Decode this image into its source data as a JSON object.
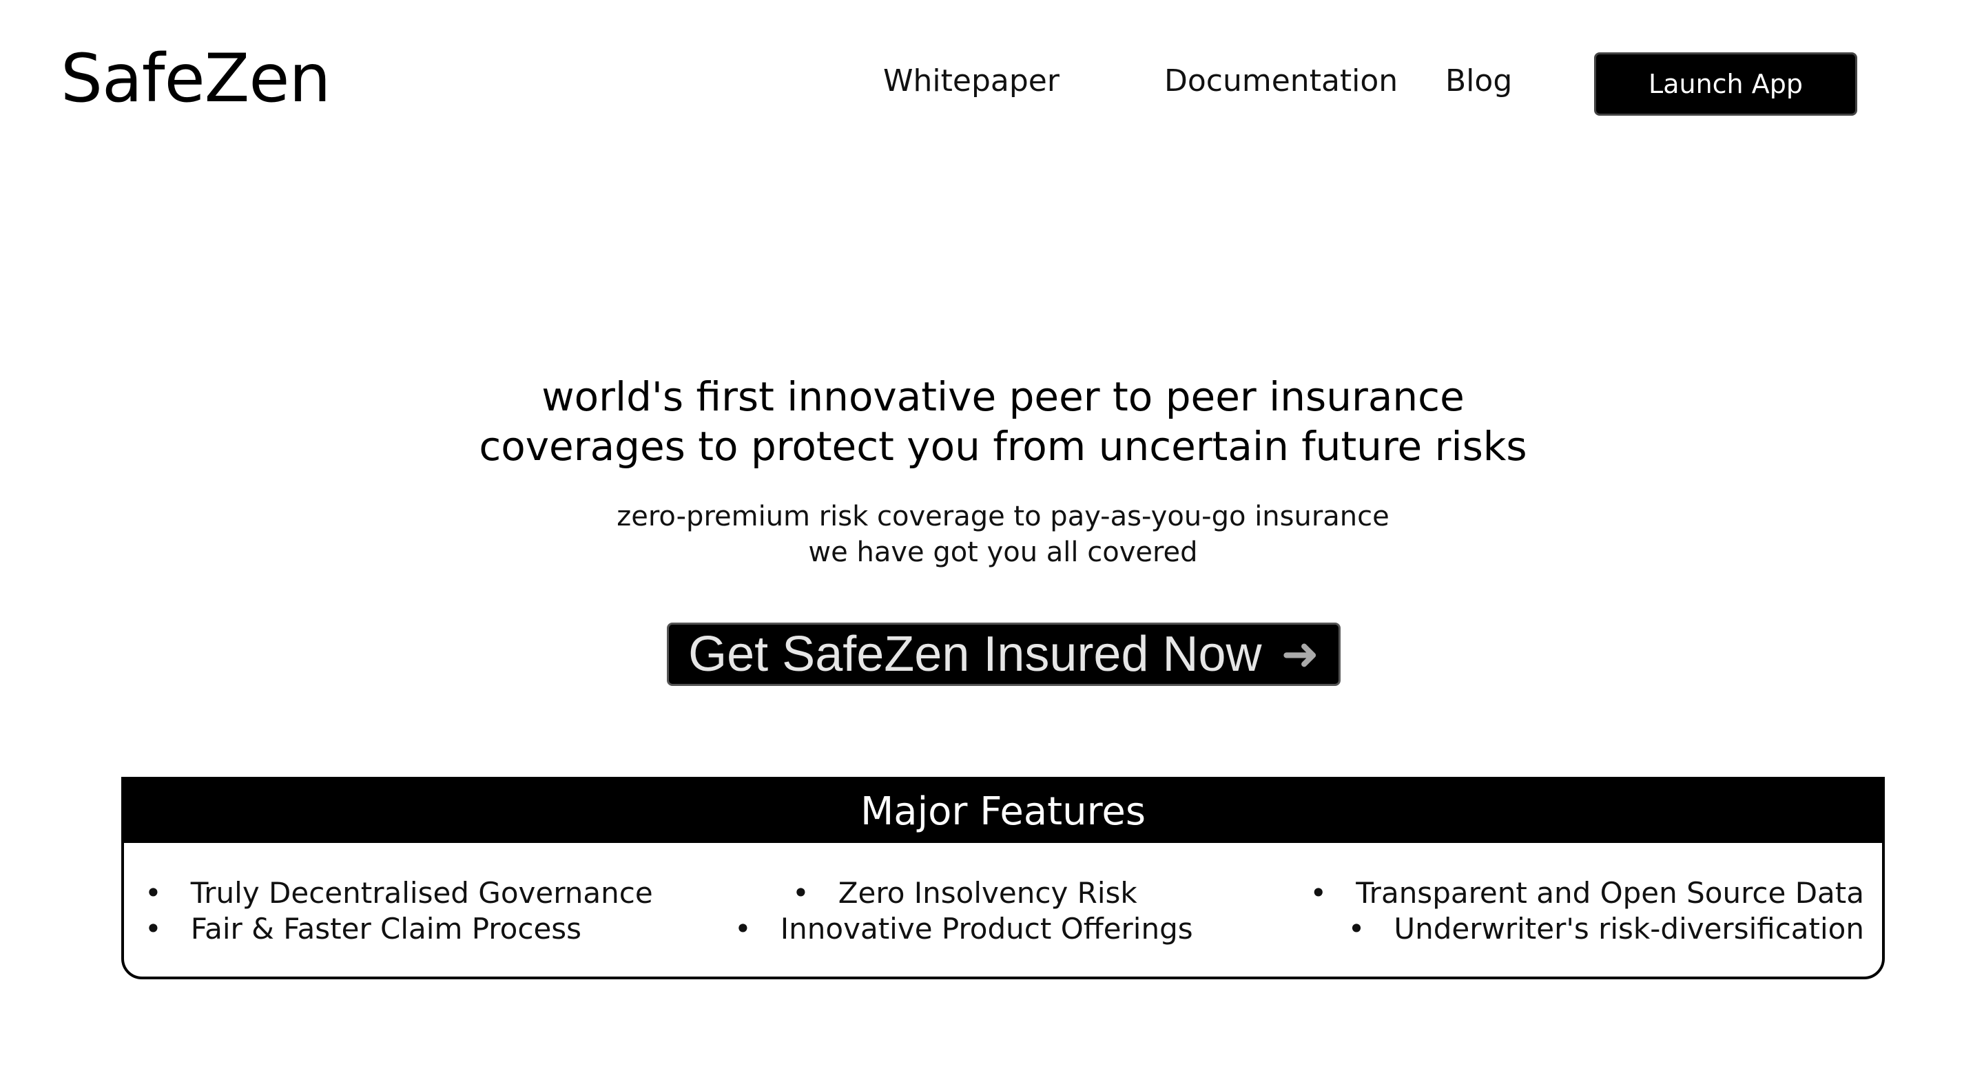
{
  "header": {
    "logo": "SafeZen",
    "nav": [
      "Whitepaper",
      "Documentation",
      "Blog"
    ],
    "launch_label": "Launch App"
  },
  "hero": {
    "title_line1": "world's first innovative peer to peer insurance",
    "title_line2": "coverages to protect you from uncertain future risks",
    "sub_line1": "zero-premium risk coverage to pay-as-you-go insurance",
    "sub_line2": "we have got you all covered",
    "cta_label": "Get SafeZen Insured Now",
    "cta_icon": "arrow-right-icon"
  },
  "features": {
    "title": "Major Features",
    "columns": [
      [
        "Truly Decentralised Governance",
        "Fair & Faster Claim Process"
      ],
      [
        "Zero Insolvency Risk",
        "Innovative Product Offerings"
      ],
      [
        "Transparent and Open Source Data",
        "Underwriter's risk-diversification"
      ]
    ]
  }
}
